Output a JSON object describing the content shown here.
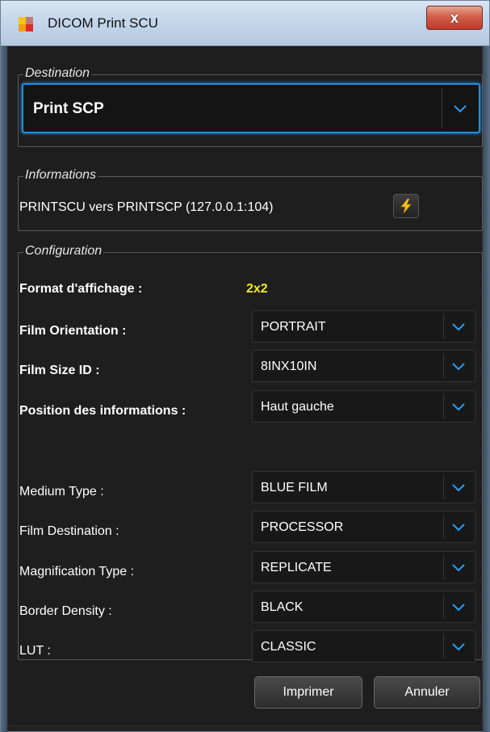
{
  "window": {
    "title": "DICOM Print SCU",
    "close_label": "x"
  },
  "destination": {
    "legend": "Destination",
    "selected": "Print SCP"
  },
  "informations": {
    "legend": "Informations",
    "text": "PRINTSCU vers PRINTSCP (127.0.0.1:104)"
  },
  "configuration": {
    "legend": "Configuration",
    "format": {
      "label": "Format d'affichage :",
      "value": "2x2"
    },
    "fields": [
      {
        "label": "Film Orientation :",
        "value": "PORTRAIT"
      },
      {
        "label": "Film Size ID :",
        "value": "8INX10IN"
      },
      {
        "label": "Position des informations :",
        "value": "Haut gauche"
      },
      {
        "label": "Medium Type :",
        "value": "BLUE FILM"
      },
      {
        "label": "Film Destination :",
        "value": "PROCESSOR"
      },
      {
        "label": "Magnification Type :",
        "value": "REPLICATE"
      },
      {
        "label": "Border Density :",
        "value": "BLACK"
      },
      {
        "label": "LUT :",
        "value": "CLASSIC"
      }
    ]
  },
  "buttons": {
    "print": "Imprimer",
    "cancel": "Annuler"
  },
  "colors": {
    "accent": "#1d8fe0",
    "format_value": "#f2ea1c",
    "background": "#1e1e1e"
  },
  "icons": {
    "app": "app-icon",
    "chevron": "chevron-down-icon",
    "lightning": "lightning-icon"
  }
}
